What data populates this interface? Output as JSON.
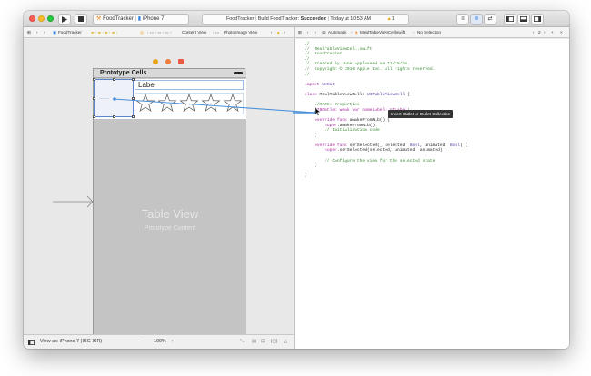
{
  "titlebar": {
    "scheme_label": "FoodTracker",
    "device_label": "iPhone 7",
    "status_project": "FoodTracker",
    "status_build_prefix": "Build FoodTracker:",
    "status_build_result": "Succeeded",
    "status_time": "Today at 10:53 AM",
    "warning_count": "1"
  },
  "jumpbar_left": {
    "crumbs": [
      "FoodTracker",
      "Content View",
      "Photo Image View"
    ],
    "warning_icon": "warning-icon"
  },
  "jumpbar_right": {
    "automatic_label": "Automatic",
    "file_label": "MealTableViewCell.swift",
    "selection_label": "No Selection",
    "counter": "2"
  },
  "scene": {
    "header_title": "Prototype Cells",
    "label_text": "Label",
    "star_count": 5,
    "table_view_title": "Table View",
    "table_view_subtitle": "Prototype Content"
  },
  "code_lines": [
    {
      "text": "//",
      "kind": "cm"
    },
    {
      "text": "//  MealTableViewCell.swift",
      "kind": "cm"
    },
    {
      "text": "//  FoodTracker",
      "kind": "cm"
    },
    {
      "text": "//",
      "kind": "cm"
    },
    {
      "text": "//  Created by Jane Appleseed on 11/15/16.",
      "kind": "cm"
    },
    {
      "text": "//  Copyright © 2016 Apple Inc. All rights reserved.",
      "kind": "cm"
    },
    {
      "text": "//",
      "kind": "cm"
    },
    {
      "text": "",
      "kind": "ln"
    },
    {
      "text": "import UIKit",
      "kind": "ln"
    },
    {
      "text": "",
      "kind": "ln"
    },
    {
      "text": "class MealTableViewCell: UITableViewCell {",
      "kind": "ln"
    },
    {
      "text": "",
      "kind": "ln"
    },
    {
      "text": "    //MARK: Properties",
      "kind": "cm"
    },
    {
      "text": "    @IBOutlet weak var nameLabel: UILabel!",
      "kind": "kw"
    },
    {
      "text": "",
      "kind": "ln"
    },
    {
      "text": "    override func awakeFromNib() {",
      "kind": "ln"
    },
    {
      "text": "        super.awakeFromNib()",
      "kind": "ln"
    },
    {
      "text": "        // Initialization code",
      "kind": "cm"
    },
    {
      "text": "    }",
      "kind": "ln"
    },
    {
      "text": "",
      "kind": "ln"
    },
    {
      "text": "    override func setSelected(_ selected: Bool, animated: Bool) {",
      "kind": "ln"
    },
    {
      "text": "        super.setSelected(selected, animated: animated)",
      "kind": "ln"
    },
    {
      "text": "",
      "kind": "ln"
    },
    {
      "text": "        // Configure the view for the selected state",
      "kind": "cm"
    },
    {
      "text": "    }",
      "kind": "ln"
    },
    {
      "text": "",
      "kind": "ln"
    },
    {
      "text": "}",
      "kind": "ln"
    }
  ],
  "tooltip": "Insert Outlet or Outlet Collection",
  "bottombar": {
    "view_as": "View as: iPhone 7 (⌘C ⌘R)",
    "zoom_minus": "—",
    "zoom": "100%",
    "zoom_plus": "+"
  },
  "colors": {
    "connection_line": "#4a90d9",
    "accent": "#1a73e8"
  }
}
